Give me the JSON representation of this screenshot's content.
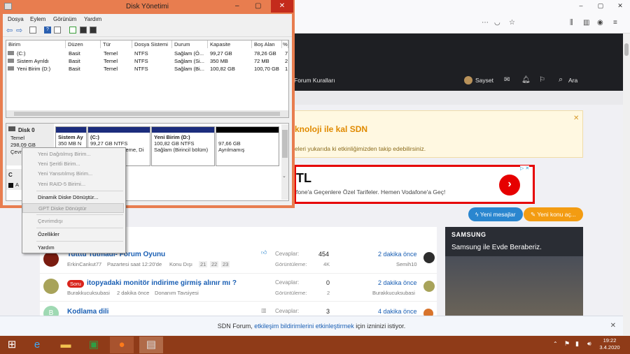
{
  "disk_manager": {
    "title": "Disk Yönetimi",
    "menu": [
      "Dosya",
      "Eylem",
      "Görünüm",
      "Yardım"
    ],
    "window_buttons": [
      "–",
      "▢",
      "✕"
    ],
    "columns": [
      "Birim",
      "Düzen",
      "Tür",
      "Dosya Sistemi",
      "Durum",
      "Kapasite",
      "Boş Alan",
      "%"
    ],
    "volumes": [
      [
        "(C:)",
        "Basit",
        "Temel",
        "NTFS",
        "Sağlam (Ö...",
        "99,27 GB",
        "78,26 GB",
        "7"
      ],
      [
        "Sistem Ayrıldı",
        "Basit",
        "Temel",
        "NTFS",
        "Sağlam (Si...",
        "350 MB",
        "72 MB",
        "2"
      ],
      [
        "Yeni Birim (D:)",
        "Basit",
        "Temel",
        "NTFS",
        "Sağlam (Bi...",
        "100,82 GB",
        "100,70 GB",
        "1"
      ]
    ],
    "disk0": {
      "name": "Disk 0",
      "type": "Temel",
      "size": "298,09 GB",
      "status": "Çevri"
    },
    "cd_label": "C",
    "cd_status": "A",
    "partitions": [
      {
        "name": "Sistem Ay",
        "size": "350 MB N",
        "detail": ""
      },
      {
        "name": "(C:)",
        "size": "99,27 GB NTFS",
        "detail": "kleme, Di"
      },
      {
        "name": "Yeni Birim  (D:)",
        "size": "100,82 GB NTFS",
        "detail": "Sağlam (Birincil bölüm)"
      },
      {
        "name": "",
        "size": "97,66 GB",
        "detail": "Ayrılmamış"
      }
    ]
  },
  "context_menu": {
    "items": [
      {
        "label": "Yeni Dağıtılmış Birim...",
        "enabled": false
      },
      {
        "label": "Yeni Şeritli Birim...",
        "enabled": false
      },
      {
        "label": "Yeni Yansıtılmış Birim...",
        "enabled": false
      },
      {
        "label": "Yeni RAID-5 Birimi...",
        "enabled": false
      },
      {
        "label": "Dinamik Diske Dönüştür...",
        "enabled": true
      },
      {
        "label": "GPT Diske Dönüştür",
        "enabled": false
      },
      {
        "label": "Çevrimdışı",
        "enabled": false
      },
      {
        "label": "Özellikler",
        "enabled": true
      },
      {
        "label": "Yardım",
        "enabled": true
      }
    ]
  },
  "browser": {
    "nav_link": "Forum Kuralları",
    "user": "Sayset",
    "search": "Ara",
    "notice_title": "knoloji ile kal SDN",
    "notice_text": "eleri yukarıda ki etkinliğimizden takip edebilirsiniz.",
    "ad_title": "TL",
    "ad_text": "fone'a Geçenlere Özel Tarifeler. Hemen Vodafone'a Geç!",
    "ad_badge": "▷ ✕",
    "btn_messages": "Yeni mesajlar",
    "btn_new_topic": "Yeni konu aç...",
    "samsung_brand": "SAMSUNG",
    "samsung_text": "Samsung ile Evde Beraberiz.",
    "cookie_text_1": "SDN Forum,",
    "cookie_link": "etkileşim bildirimlerini etkinleştirmek",
    "cookie_text_2": "için izninizi istiyor.",
    "close": "✕",
    "threads": [
      {
        "title": "Tutttu Tutmadı- Forum Oyunu",
        "author": "ErkinCankut77",
        "when": "Pazartesi saat 12:20'de",
        "forum": "Konu Dışı",
        "pages": [
          "21",
          "22",
          "23"
        ],
        "replies_label": "Cevaplar:",
        "replies": "454",
        "views_label": "Görüntüleme:",
        "views": "4K",
        "last": "2 dakika önce",
        "last_user": "Semih10",
        "prefix": ""
      },
      {
        "title": "itopyadaki monitör indirime girmiş alınır mı ?",
        "author": "Burakkucuksubasi",
        "when": "2 dakika önce",
        "forum": "Donanım Tavsiyesi",
        "pages": [],
        "replies_label": "Cevaplar:",
        "replies": "0",
        "views_label": "Görüntüleme:",
        "views": "2",
        "last": "2 dakika önce",
        "last_user": "Burakkucuksubasi",
        "prefix": "Soru"
      },
      {
        "title": "Kodlama dili",
        "author": "",
        "when": "",
        "forum": "",
        "pages": [],
        "replies_label": "Cevaplar:",
        "replies": "3",
        "views_label": "",
        "views": "",
        "last": "4 dakika önce",
        "last_user": "",
        "prefix": ""
      }
    ]
  },
  "taskbar": {
    "time": "19:22",
    "date": "3.4.2020"
  },
  "colors": {
    "window_frame": "#e87d4f",
    "taskbar": "#8f3b18",
    "partition_bar": "#1c2d7d",
    "unallocated_bar": "#000000",
    "link": "#1a5fb4",
    "accent_orange": "#f39c12",
    "ad_red": "#e60000"
  }
}
